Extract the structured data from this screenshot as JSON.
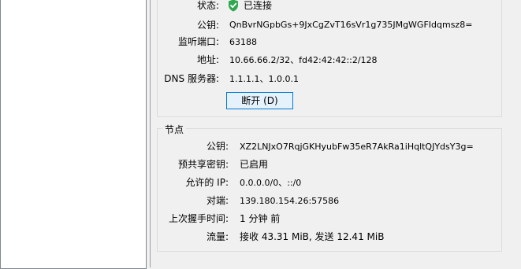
{
  "interface": {
    "status_label": "状态:",
    "status_value": "已连接",
    "public_key_label": "公钥:",
    "public_key_value": "QnBvrNGpbGs+9JxCgZvT16sVr1g735JMgWGFIdqmsz8=",
    "listen_port_label": "监听端口:",
    "listen_port_value": "63188",
    "address_label": "地址:",
    "address_value": "10.66.66.2/32、fd42:42:42::2/128",
    "dns_label": "DNS 服务器:",
    "dns_value": "1.1.1.1、1.0.0.1",
    "disconnect_button": "断开 (D)"
  },
  "peer": {
    "section_title": "节点",
    "public_key_label": "公钥:",
    "public_key_value": "XZ2LNJxO7RqjGKHyubFw35eR7AkRa1iHqltQJYdsY3g=",
    "psk_label": "预共享密钥:",
    "psk_value": "已启用",
    "allowed_ips_label": "允许的 IP:",
    "allowed_ips_value": "0.0.0.0/0、::/0",
    "endpoint_label": "对端:",
    "endpoint_value": "139.180.154.26:57586",
    "handshake_label": "上次握手时间:",
    "handshake_value": "1 分钟 前",
    "transfer_label": "流量:",
    "transfer_value": "接收 43.31 MiB, 发送 12.41 MiB"
  },
  "icons": {
    "status": "shield-check-icon"
  },
  "colors": {
    "status_green": "#2fa84f",
    "button_border": "#0078d7",
    "button_fill": "#e5f1fb"
  }
}
